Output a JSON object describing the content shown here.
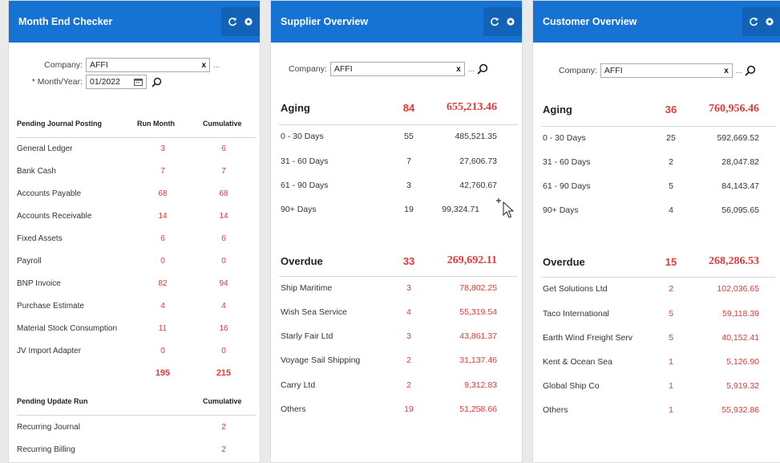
{
  "colors": {
    "header": "#1673d4",
    "accent_red": "#e03b3b"
  },
  "month_end_checker": {
    "title": "Month End Checker",
    "company_label": "Company:",
    "company_value": "AFFI",
    "clear": "x",
    "ellipsis": "...",
    "month_label": "* Month/Year:",
    "month_value": "01/2022",
    "pending_journal": {
      "headers": [
        "Pending Journal Posting",
        "Run Month",
        "Cumulative"
      ],
      "rows": [
        {
          "name": "General Ledger",
          "run": "3",
          "cum": "6"
        },
        {
          "name": "Bank Cash",
          "run": "7",
          "cum": "7"
        },
        {
          "name": "Accounts Payable",
          "run": "68",
          "cum": "68"
        },
        {
          "name": "Accounts Receivable",
          "run": "14",
          "cum": "14"
        },
        {
          "name": "Fixed Assets",
          "run": "6",
          "cum": "6"
        },
        {
          "name": "Payroll",
          "run": "0",
          "cum": "0"
        },
        {
          "name": "BNP Invoice",
          "run": "82",
          "cum": "94"
        },
        {
          "name": "Purchase Estimate",
          "run": "4",
          "cum": "4"
        },
        {
          "name": "Material Stock Consumption",
          "run": "11",
          "cum": "16"
        },
        {
          "name": "JV Import Adapter",
          "run": "0",
          "cum": "0"
        }
      ],
      "total_run": "195",
      "total_cum": "215"
    },
    "pending_update": {
      "headers": [
        "Pending Update Run",
        "Cumulative"
      ],
      "rows": [
        {
          "name": "Recurring Journal",
          "cum": "2"
        },
        {
          "name": "Recurring Billing",
          "cum": "2"
        }
      ]
    }
  },
  "supplier_overview": {
    "title": "Supplier Overview",
    "company_label": "Company:",
    "company_value": "AFFI",
    "clear": "x",
    "ellipsis": "...",
    "aging": {
      "label": "Aging",
      "count": "84",
      "amount": "655,213.46"
    },
    "aging_rows": [
      {
        "name": "0 - 30 Days",
        "count": "55",
        "amount": "485,521.35"
      },
      {
        "name": "31 - 60 Days",
        "count": "7",
        "amount": "27,606.73"
      },
      {
        "name": "61 - 90 Days",
        "count": "3",
        "amount": "42,760.67"
      },
      {
        "name": "90+ Days",
        "count": "19",
        "amount": "99,324.71"
      }
    ],
    "overdue": {
      "label": "Overdue",
      "count": "33",
      "amount": "269,692.11"
    },
    "overdue_rows": [
      {
        "name": "Ship Maritime",
        "count": "3",
        "amount": "78,802.25"
      },
      {
        "name": "Wish Sea Service",
        "count": "4",
        "amount": "55,319.54"
      },
      {
        "name": "Starly Fair Ltd",
        "count": "3",
        "amount": "43,861.37"
      },
      {
        "name": "Voyage Sail Shipping",
        "count": "2",
        "amount": "31,137.46"
      },
      {
        "name": "Carry Ltd",
        "count": "2",
        "amount": "9,312.83"
      },
      {
        "name": "Others",
        "count": "19",
        "amount": "51,258.66"
      }
    ]
  },
  "customer_overview": {
    "title": "Customer Overview",
    "company_label": "Company:",
    "company_value": "AFFI",
    "clear": "x",
    "ellipsis": "...",
    "aging": {
      "label": "Aging",
      "count": "36",
      "amount": "760,956.46"
    },
    "aging_rows": [
      {
        "name": "0 - 30 Days",
        "count": "25",
        "amount": "592,669.52"
      },
      {
        "name": "31 - 60 Days",
        "count": "2",
        "amount": "28,047.82"
      },
      {
        "name": "61 - 90 Days",
        "count": "5",
        "amount": "84,143.47"
      },
      {
        "name": "90+ Days",
        "count": "4",
        "amount": "56,095.65"
      }
    ],
    "overdue": {
      "label": "Overdue",
      "count": "15",
      "amount": "268,286.53"
    },
    "overdue_rows": [
      {
        "name": "Get Solutions Ltd",
        "count": "2",
        "amount": "102,036.65"
      },
      {
        "name": "Taco International",
        "count": "5",
        "amount": "59,118.39"
      },
      {
        "name": "Earth Wind Freight Serv",
        "count": "5",
        "amount": "40,152.41"
      },
      {
        "name": "Kent & Ocean Sea",
        "count": "1",
        "amount": "5,126.90"
      },
      {
        "name": "Global Ship Co",
        "count": "1",
        "amount": "5,919.32"
      },
      {
        "name": "Others",
        "count": "1",
        "amount": "55,932.86"
      }
    ]
  }
}
